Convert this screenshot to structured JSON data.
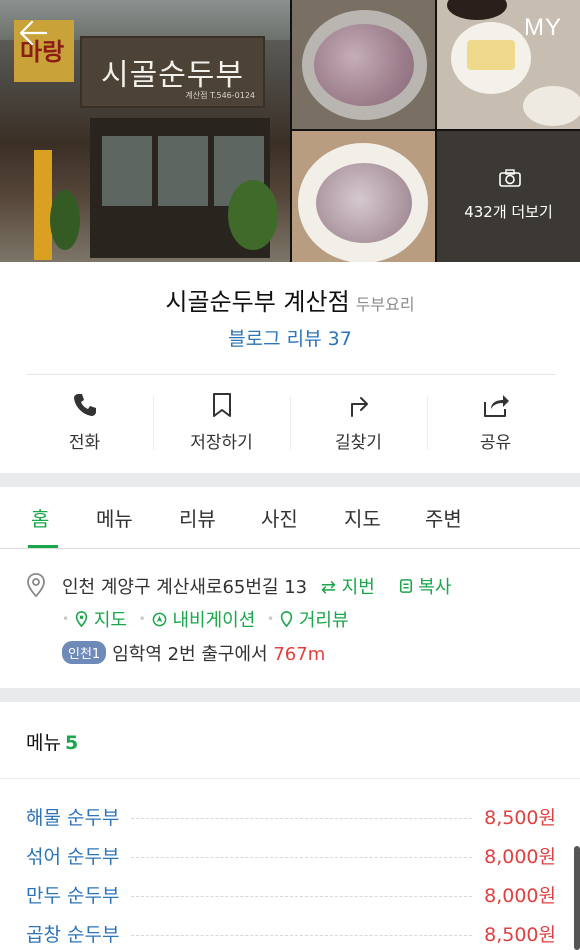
{
  "header": {
    "my_label": "MY",
    "photo_more": "432개 더보기",
    "sign_text": "시골순두부",
    "sign_sub": "계산점 T.546-0124",
    "left_sign": "마랑"
  },
  "place": {
    "name": "시골순두부 계산점",
    "category": "두부요리",
    "blog_review": "블로그 리뷰 37"
  },
  "actions": [
    {
      "label": "전화",
      "icon": "phone-icon"
    },
    {
      "label": "저장하기",
      "icon": "bookmark-icon"
    },
    {
      "label": "길찾기",
      "icon": "directions-icon"
    },
    {
      "label": "공유",
      "icon": "share-icon"
    }
  ],
  "tabs": [
    "홈",
    "메뉴",
    "리뷰",
    "사진",
    "지도",
    "주변"
  ],
  "address": {
    "text": "인천 계양구 계산새로65번길 13",
    "lot_toggle": "⇄ 지번",
    "copy": "복사",
    "map": "지도",
    "navigation": "내비게이션",
    "street_view": "거리뷰",
    "transit_line": "인천1",
    "station": "임학역",
    "exit_text": "2번 출구에서",
    "distance": "767m"
  },
  "menu": {
    "title": "메뉴",
    "count": "5",
    "items": [
      {
        "name": "해물 순두부",
        "price": "8,500원"
      },
      {
        "name": "섞어 순두부",
        "price": "8,000원"
      },
      {
        "name": "만두 순두부",
        "price": "8,000원"
      },
      {
        "name": "곱창 순두부",
        "price": "8,500원"
      }
    ]
  },
  "colors": {
    "accent_green": "#1aa64a",
    "link_blue": "#2d74b8",
    "price_red": "#e04040"
  }
}
